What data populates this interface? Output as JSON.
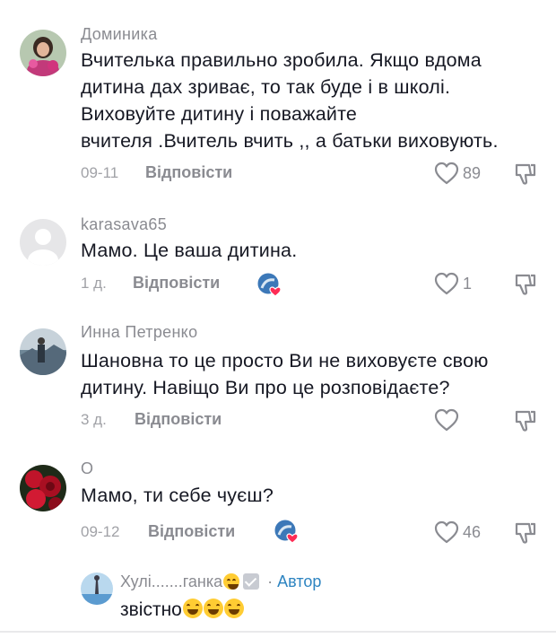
{
  "colors": {
    "primary_text": "#161823",
    "secondary_text": "#8a8b91",
    "author": "#2d84c1",
    "liked": "#fe2c55"
  },
  "reply_label": "Відповісти",
  "comments": [
    {
      "username": "Доминика",
      "lines": [
        "Вчителька правильно зробила. Якщо вдома",
        "дитина дах зриває, то так буде і в школі.",
        "Виховуйте дитину і поважайте",
        "вчителя .Вчитель вчить ,, а батьки виховують."
      ],
      "date": "09-11",
      "likes": "89",
      "creator_liked": false
    },
    {
      "username": "karasava65",
      "lines": [
        "Мамо. Це ваша дитина."
      ],
      "date": "1 д.",
      "likes": "1",
      "creator_liked": true
    },
    {
      "username": "Инна Петренко",
      "lines": [
        "Шановна то це просто Ви не виховуєте свою",
        "дитину. Навіщо Ви про це розповідаєте?"
      ],
      "date": "3 д.",
      "likes": "",
      "creator_liked": false
    },
    {
      "username": "О",
      "lines": [
        "Мамо, ти себе чуєш?"
      ],
      "date": "09-12",
      "likes": "46",
      "creator_liked": true
    }
  ],
  "reply": {
    "username": "Хулі.......ганка",
    "separator": "·",
    "author_label": "Автор",
    "text": "звістно"
  }
}
